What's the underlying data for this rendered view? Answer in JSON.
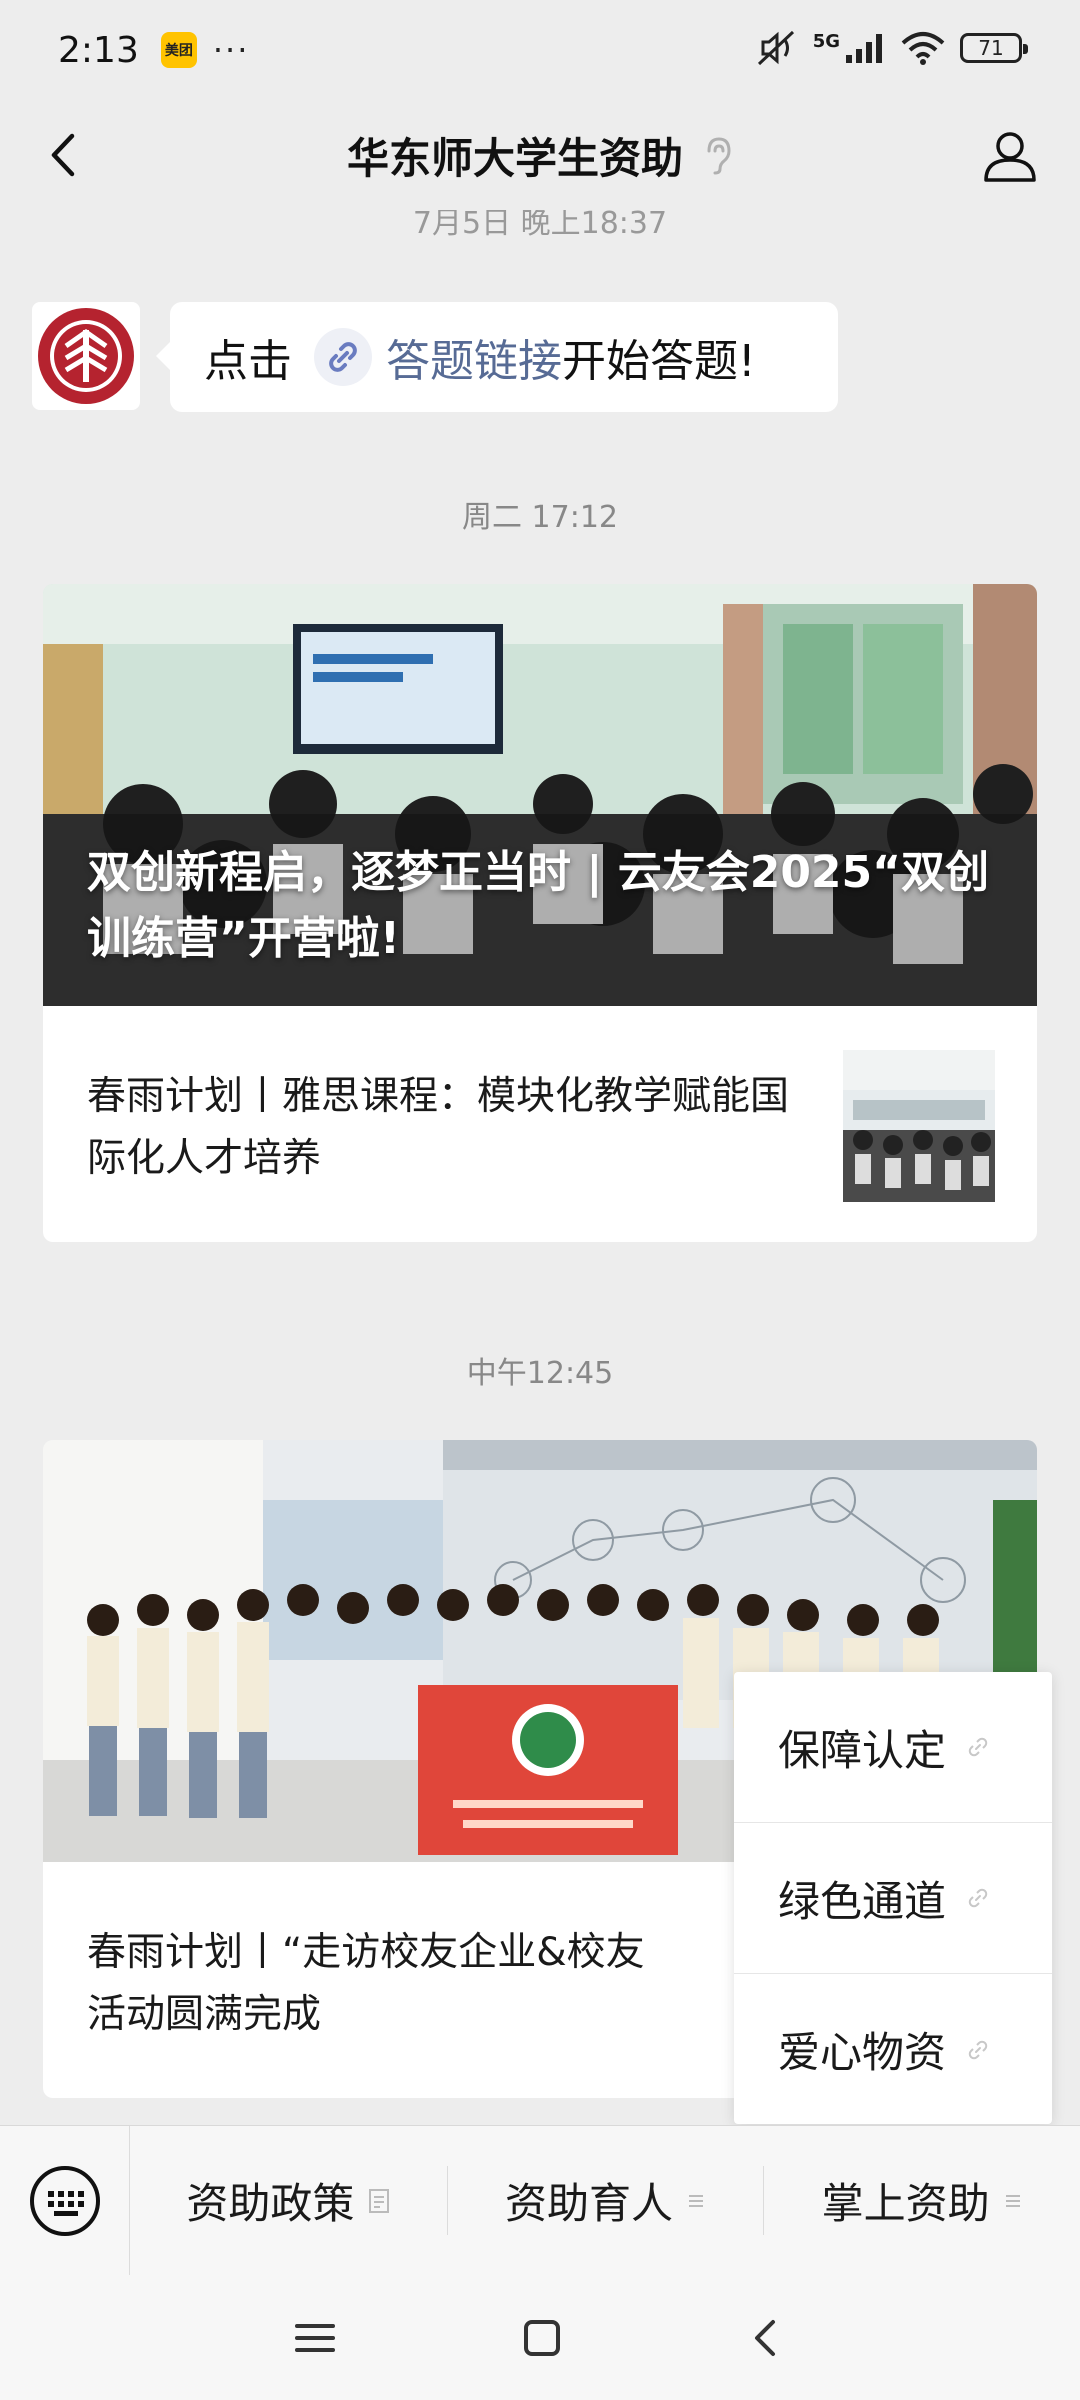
{
  "status_bar": {
    "time": "2:13",
    "app_badge": "美团",
    "more": "···",
    "network": "5G",
    "battery": "71"
  },
  "header": {
    "title": "华东师大学生资助"
  },
  "chat": {
    "partial_time": "7月5日 晚上18:37",
    "message": {
      "prefix": "点击",
      "link": "答题链接",
      "suffix": "开始答题!"
    },
    "time_1": "周二 17:12",
    "article_1": {
      "cover_title": "双创新程启，逐梦正当时 | 云友会2025“双创训练营”开营啦!",
      "sub_title": "春雨计划丨雅思课程：模块化教学赋能国际化人才培养"
    },
    "time_2": "中午12:45",
    "article_2": {
      "cover_title": "",
      "sub_title": "春雨计划丨“走访校友企业&校友",
      "sub_title_line2": "活动圆满完成"
    }
  },
  "popup_menu": {
    "items": [
      {
        "label": "保障认定"
      },
      {
        "label": "绿色通道"
      },
      {
        "label": "爱心物资"
      }
    ]
  },
  "bottom_menu": {
    "items": [
      {
        "label": "资助政策"
      },
      {
        "label": "资助育人"
      },
      {
        "label": "掌上资助"
      }
    ]
  },
  "colors": {
    "link": "#576b95",
    "background": "#ededed",
    "flag_red": "#e0463a"
  }
}
